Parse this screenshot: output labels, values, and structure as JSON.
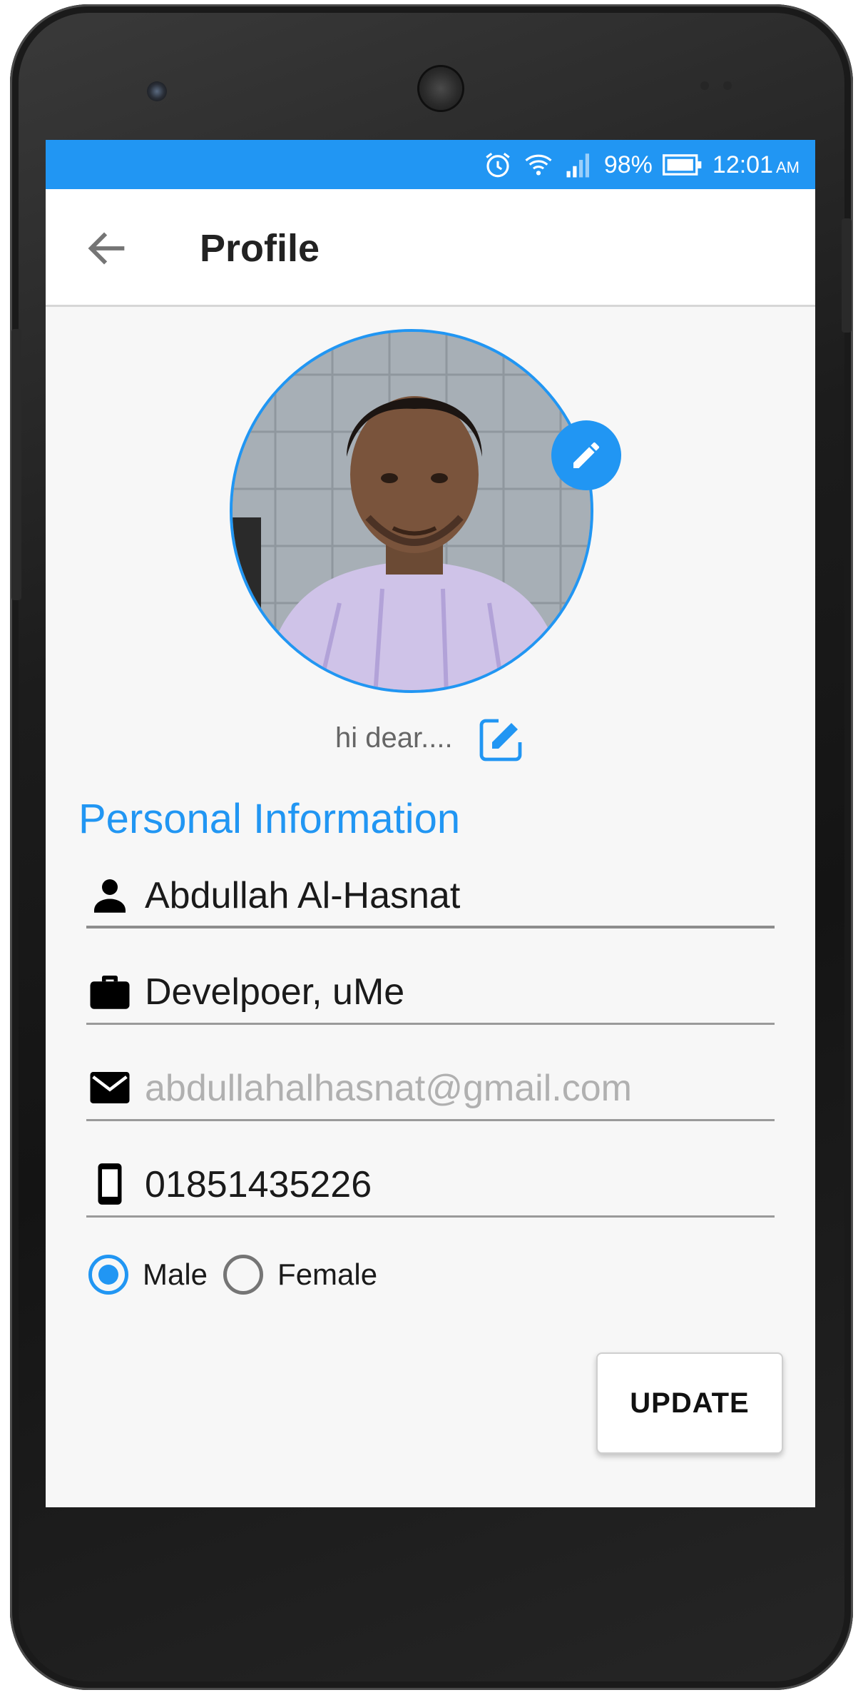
{
  "status_bar": {
    "battery": "98%",
    "time": "12:01",
    "ampm": "AM",
    "icons": [
      "alarm-icon",
      "wifi-icon",
      "signal-icon",
      "battery-icon"
    ]
  },
  "app_bar": {
    "title": "Profile",
    "back_icon": "arrow-left-icon"
  },
  "profile": {
    "status_text": "hi dear....",
    "photo_edit_icon": "pencil-icon",
    "status_edit_icon": "edit-square-icon"
  },
  "section": {
    "title": "Personal Information"
  },
  "fields": {
    "name": {
      "value": "Abdullah Al-Hasnat",
      "icon": "person-icon"
    },
    "work": {
      "value": "Develpoer, uMe",
      "icon": "briefcase-icon"
    },
    "email": {
      "placeholder": "abdullahalhasnat@gmail.com",
      "icon": "email-icon"
    },
    "phone": {
      "value": "01851435226",
      "icon": "phone-icon"
    }
  },
  "gender": {
    "male_label": "Male",
    "female_label": "Female",
    "selected": "Male"
  },
  "actions": {
    "update_label": "UPDATE"
  },
  "colors": {
    "accent": "#2196f3",
    "background": "#f7f7f7",
    "text": "#1a1a1a"
  }
}
